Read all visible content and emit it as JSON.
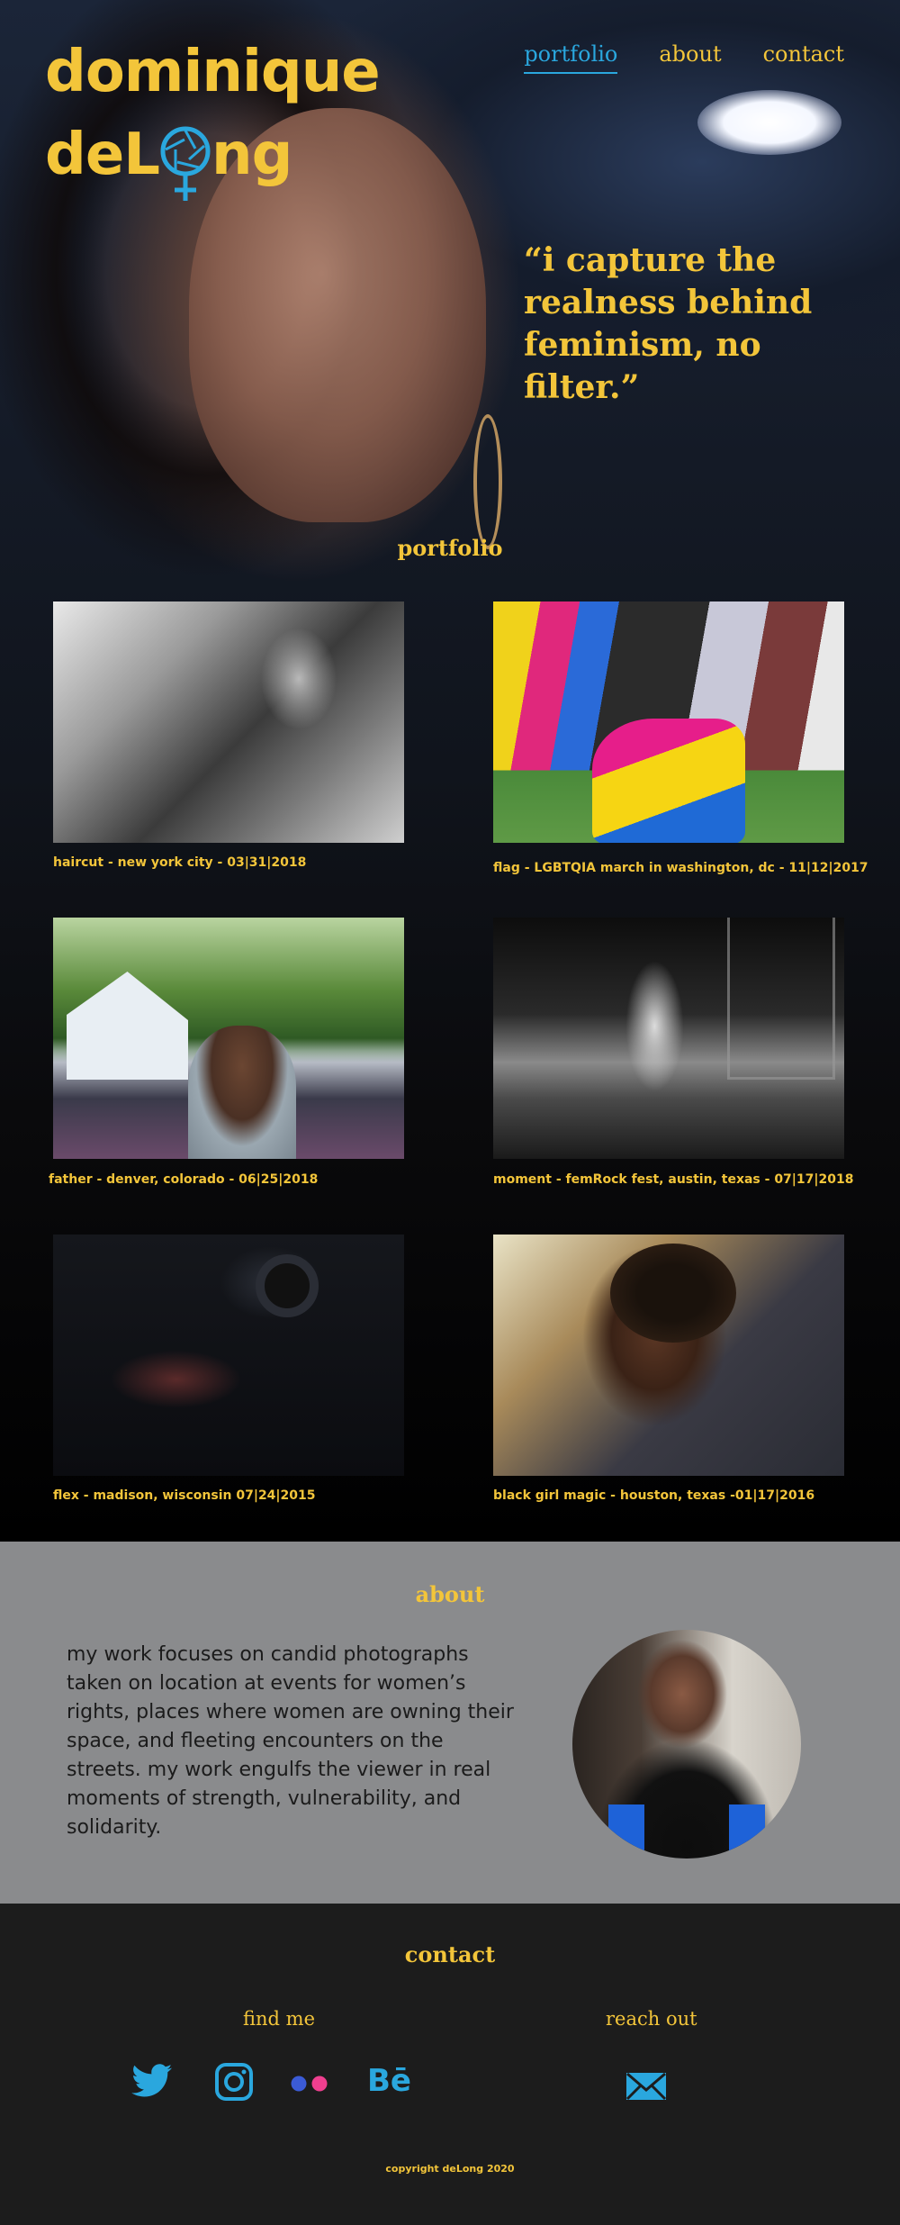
{
  "brand": {
    "logo_line1": "dominique",
    "logo_line2_pre": "deL",
    "logo_line2_post": "ng"
  },
  "nav": {
    "items": [
      {
        "label": "portfolio",
        "active": true
      },
      {
        "label": "about",
        "active": false
      },
      {
        "label": "contact",
        "active": false
      }
    ]
  },
  "hero": {
    "quote": "“i capture the realness behind feminism, no filter.”"
  },
  "portfolio": {
    "title": "portfolio",
    "items": [
      {
        "caption": "haircut - new york city - 03|31|2018"
      },
      {
        "caption": "flag - LGBTQIA march in washington, dc - 11|12|2017"
      },
      {
        "caption": "father - denver, colorado - 06|25|2018"
      },
      {
        "caption": "moment - femRock fest, austin, texas - 07|17|2018"
      },
      {
        "caption": "flex - madison, wisconsin 07|24|2015"
      },
      {
        "caption": "black girl magic - houston, texas -01|17|2016"
      }
    ]
  },
  "about": {
    "title": "about",
    "text": "my work focuses on candid photographs taken on location at events for women’s rights, places where women are owning their space, and fleeting encounters on the streets. my work engulfs the viewer in real moments of strength, vulnerability, and solidarity."
  },
  "contact": {
    "title": "contact",
    "find_me": "find me",
    "reach_out": "reach out",
    "social_icons": [
      "twitter-icon",
      "instagram-icon",
      "flickr-icon",
      "behance-icon"
    ],
    "behance_label": "Bē",
    "mail_icon": "mail-icon",
    "copyright": "copyright deLong 2020"
  },
  "colors": {
    "accent_yellow": "#f3c53a",
    "accent_blue": "#2aa7de",
    "about_bg": "#8a8b8d",
    "contact_bg": "#1c1c1c",
    "flickr_blue": "#3b5bd6",
    "flickr_pink": "#ef3f8f"
  }
}
